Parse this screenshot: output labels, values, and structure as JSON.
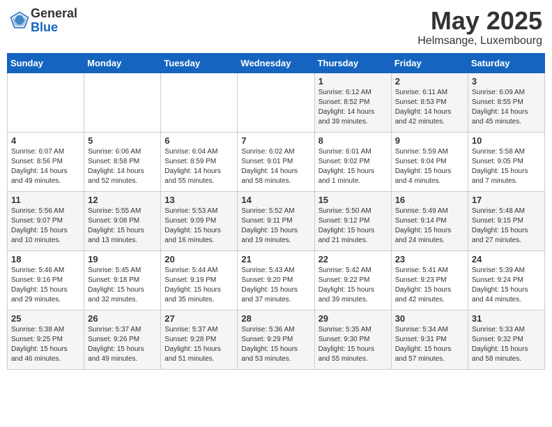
{
  "header": {
    "logo_general": "General",
    "logo_blue": "Blue",
    "title": "May 2025",
    "subtitle": "Helmsange, Luxembourg"
  },
  "days_of_week": [
    "Sunday",
    "Monday",
    "Tuesday",
    "Wednesday",
    "Thursday",
    "Friday",
    "Saturday"
  ],
  "weeks": [
    [
      {
        "num": "",
        "info": ""
      },
      {
        "num": "",
        "info": ""
      },
      {
        "num": "",
        "info": ""
      },
      {
        "num": "",
        "info": ""
      },
      {
        "num": "1",
        "info": "Sunrise: 6:12 AM\nSunset: 8:52 PM\nDaylight: 14 hours and 39 minutes."
      },
      {
        "num": "2",
        "info": "Sunrise: 6:11 AM\nSunset: 8:53 PM\nDaylight: 14 hours and 42 minutes."
      },
      {
        "num": "3",
        "info": "Sunrise: 6:09 AM\nSunset: 8:55 PM\nDaylight: 14 hours and 45 minutes."
      }
    ],
    [
      {
        "num": "4",
        "info": "Sunrise: 6:07 AM\nSunset: 8:56 PM\nDaylight: 14 hours and 49 minutes."
      },
      {
        "num": "5",
        "info": "Sunrise: 6:06 AM\nSunset: 8:58 PM\nDaylight: 14 hours and 52 minutes."
      },
      {
        "num": "6",
        "info": "Sunrise: 6:04 AM\nSunset: 8:59 PM\nDaylight: 14 hours and 55 minutes."
      },
      {
        "num": "7",
        "info": "Sunrise: 6:02 AM\nSunset: 9:01 PM\nDaylight: 14 hours and 58 minutes."
      },
      {
        "num": "8",
        "info": "Sunrise: 6:01 AM\nSunset: 9:02 PM\nDaylight: 15 hours and 1 minute."
      },
      {
        "num": "9",
        "info": "Sunrise: 5:59 AM\nSunset: 9:04 PM\nDaylight: 15 hours and 4 minutes."
      },
      {
        "num": "10",
        "info": "Sunrise: 5:58 AM\nSunset: 9:05 PM\nDaylight: 15 hours and 7 minutes."
      }
    ],
    [
      {
        "num": "11",
        "info": "Sunrise: 5:56 AM\nSunset: 9:07 PM\nDaylight: 15 hours and 10 minutes."
      },
      {
        "num": "12",
        "info": "Sunrise: 5:55 AM\nSunset: 9:08 PM\nDaylight: 15 hours and 13 minutes."
      },
      {
        "num": "13",
        "info": "Sunrise: 5:53 AM\nSunset: 9:09 PM\nDaylight: 15 hours and 16 minutes."
      },
      {
        "num": "14",
        "info": "Sunrise: 5:52 AM\nSunset: 9:11 PM\nDaylight: 15 hours and 19 minutes."
      },
      {
        "num": "15",
        "info": "Sunrise: 5:50 AM\nSunset: 9:12 PM\nDaylight: 15 hours and 21 minutes."
      },
      {
        "num": "16",
        "info": "Sunrise: 5:49 AM\nSunset: 9:14 PM\nDaylight: 15 hours and 24 minutes."
      },
      {
        "num": "17",
        "info": "Sunrise: 5:48 AM\nSunset: 9:15 PM\nDaylight: 15 hours and 27 minutes."
      }
    ],
    [
      {
        "num": "18",
        "info": "Sunrise: 5:46 AM\nSunset: 9:16 PM\nDaylight: 15 hours and 29 minutes."
      },
      {
        "num": "19",
        "info": "Sunrise: 5:45 AM\nSunset: 9:18 PM\nDaylight: 15 hours and 32 minutes."
      },
      {
        "num": "20",
        "info": "Sunrise: 5:44 AM\nSunset: 9:19 PM\nDaylight: 15 hours and 35 minutes."
      },
      {
        "num": "21",
        "info": "Sunrise: 5:43 AM\nSunset: 9:20 PM\nDaylight: 15 hours and 37 minutes."
      },
      {
        "num": "22",
        "info": "Sunrise: 5:42 AM\nSunset: 9:22 PM\nDaylight: 15 hours and 39 minutes."
      },
      {
        "num": "23",
        "info": "Sunrise: 5:41 AM\nSunset: 9:23 PM\nDaylight: 15 hours and 42 minutes."
      },
      {
        "num": "24",
        "info": "Sunrise: 5:39 AM\nSunset: 9:24 PM\nDaylight: 15 hours and 44 minutes."
      }
    ],
    [
      {
        "num": "25",
        "info": "Sunrise: 5:38 AM\nSunset: 9:25 PM\nDaylight: 15 hours and 46 minutes."
      },
      {
        "num": "26",
        "info": "Sunrise: 5:37 AM\nSunset: 9:26 PM\nDaylight: 15 hours and 49 minutes."
      },
      {
        "num": "27",
        "info": "Sunrise: 5:37 AM\nSunset: 9:28 PM\nDaylight: 15 hours and 51 minutes."
      },
      {
        "num": "28",
        "info": "Sunrise: 5:36 AM\nSunset: 9:29 PM\nDaylight: 15 hours and 53 minutes."
      },
      {
        "num": "29",
        "info": "Sunrise: 5:35 AM\nSunset: 9:30 PM\nDaylight: 15 hours and 55 minutes."
      },
      {
        "num": "30",
        "info": "Sunrise: 5:34 AM\nSunset: 9:31 PM\nDaylight: 15 hours and 57 minutes."
      },
      {
        "num": "31",
        "info": "Sunrise: 5:33 AM\nSunset: 9:32 PM\nDaylight: 15 hours and 58 minutes."
      }
    ]
  ]
}
